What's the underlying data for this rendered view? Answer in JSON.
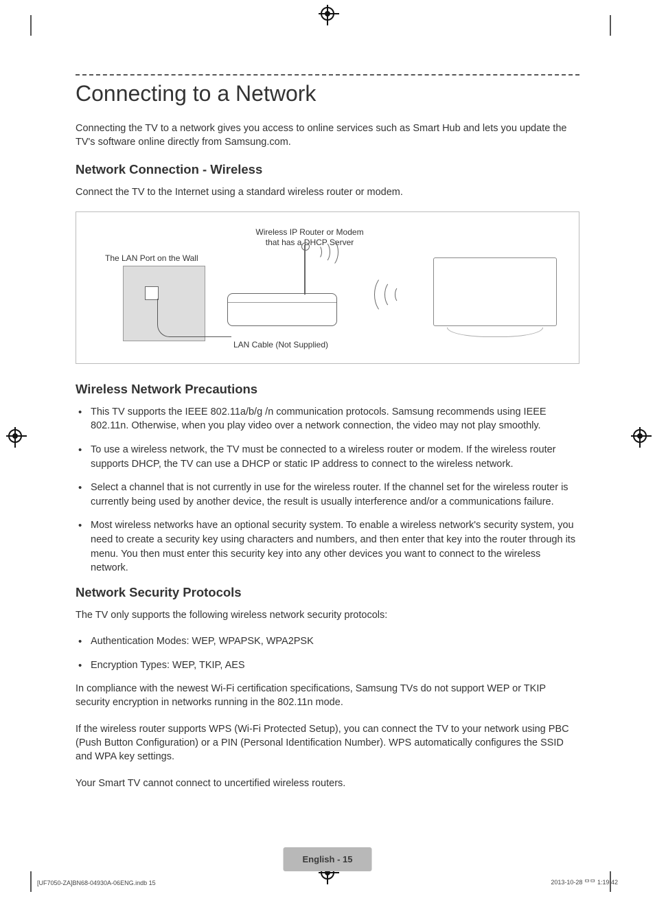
{
  "title": "Connecting to a Network",
  "intro": "Connecting the TV to a network gives you access to online services such as Smart Hub and lets you update the TV's software online directly from Samsung.com.",
  "section1_heading": "Network Connection - Wireless",
  "section1_intro": "Connect the TV to the Internet using a standard wireless router or modem.",
  "diagram": {
    "router_label": "Wireless IP Router or Modem\nthat has a DHCP Server",
    "wall_label": "The LAN Port on the Wall",
    "cable_label": "LAN Cable (Not Supplied)"
  },
  "section2_heading": "Wireless Network Precautions",
  "precautions": [
    "This TV supports the IEEE 802.11a/b/g /n communication protocols. Samsung recommends using IEEE 802.11n. Otherwise, when you play video over a network connection, the video may not play smoothly.",
    "To use a wireless network, the TV must be connected to a wireless router or modem. If the wireless router supports DHCP, the TV can use a DHCP or static IP address to connect to the wireless network.",
    "Select a channel that is not currently in use for the wireless router. If the channel set for the wireless router is currently being used by another device, the result is usually interference and/or a communications failure.",
    "Most wireless networks have an optional security system. To enable a wireless network's security system, you need to create a security key using characters and numbers, and then enter that key into the router through its menu. You then must enter this security key into any other devices you want to connect to the wireless network."
  ],
  "section3_heading": "Network Security Protocols",
  "section3_intro": "The TV only supports the following wireless network security protocols:",
  "protocols": [
    "Authentication Modes: WEP, WPAPSK, WPA2PSK",
    "Encryption Types: WEP, TKIP, AES"
  ],
  "section3_p1": "In compliance with the newest Wi-Fi certification specifications, Samsung TVs do not support WEP or TKIP security encryption in networks running in the 802.11n mode.",
  "section3_p2": "If the wireless router supports WPS (Wi-Fi Protected Setup), you can connect the TV to your network using PBC (Push Button Configuration) or a PIN (Personal Identification Number). WPS automatically configures the SSID and WPA key settings.",
  "section3_p3": "Your Smart TV cannot connect to uncertified wireless routers.",
  "footer_page": "English - 15",
  "footer_left": "[UF7050-ZA]BN68-04930A-06ENG.indb   15",
  "footer_right": "2013-10-28   ᄆᄆ 1:19:42"
}
